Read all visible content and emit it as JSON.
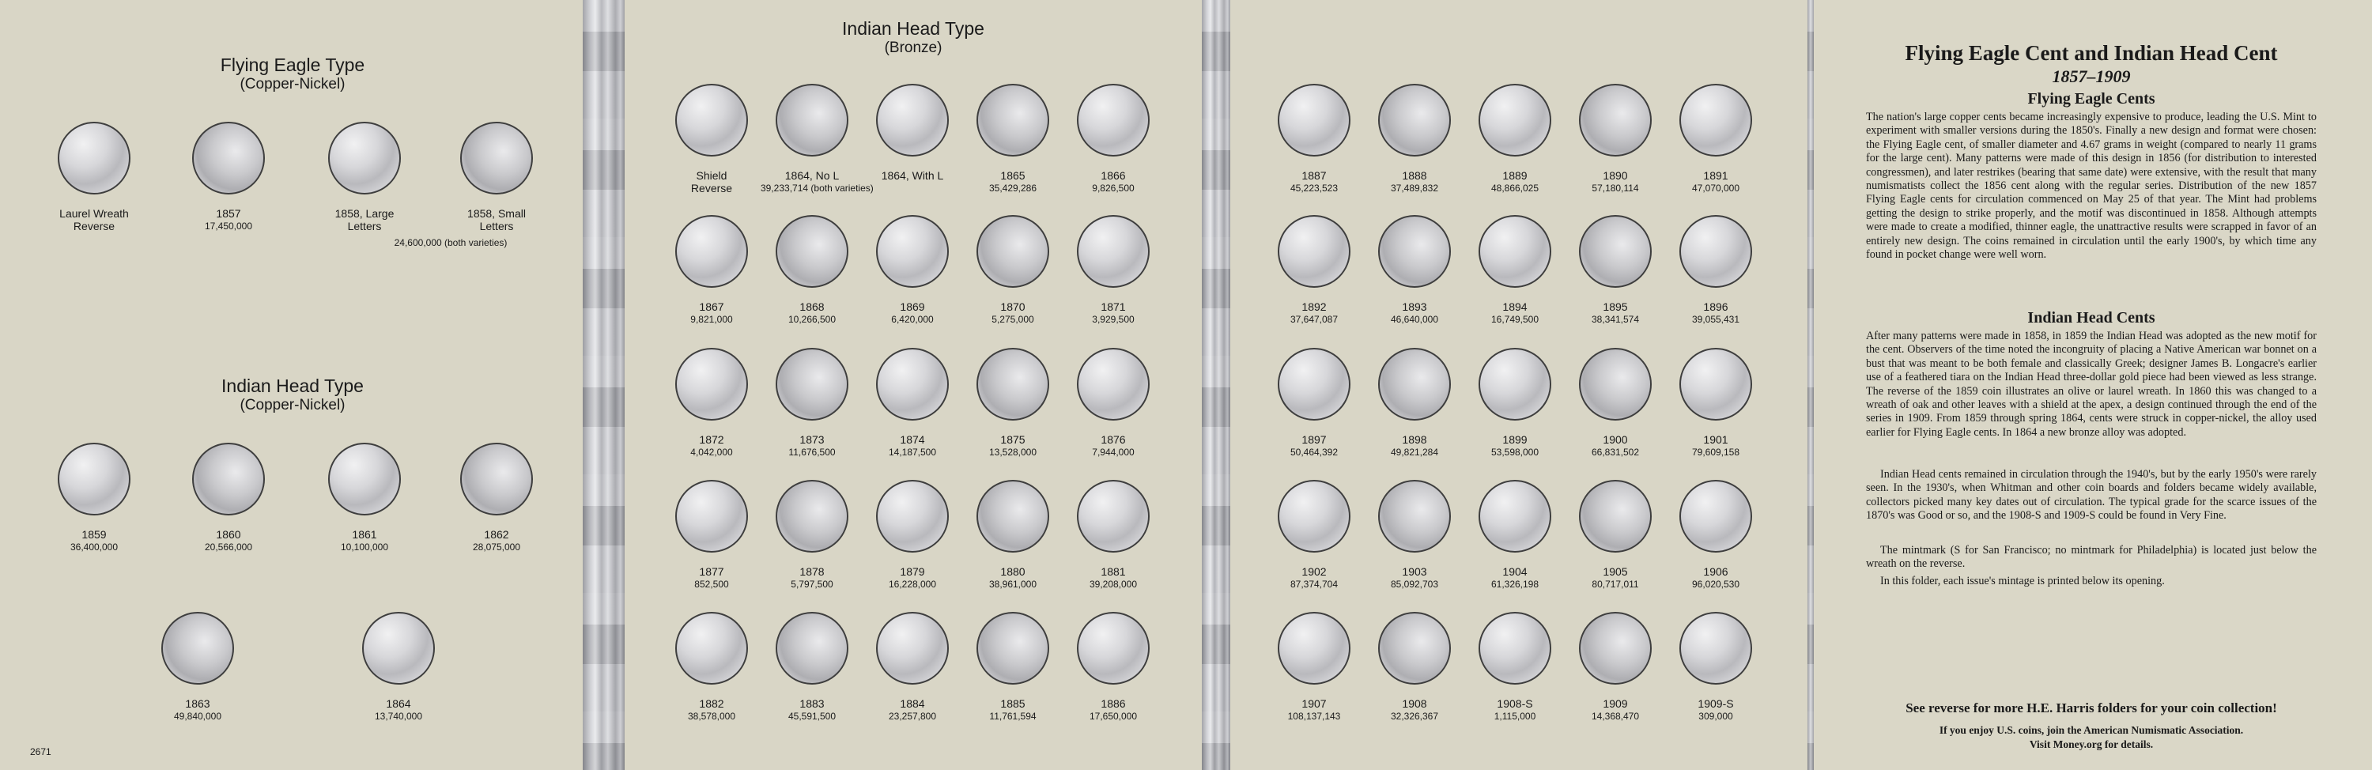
{
  "catalog_number": "2671",
  "left_panel": {
    "flying_eagle": {
      "title": "Flying Eagle Type",
      "subtitle": "(Copper-Nickel)",
      "coins": [
        {
          "label": "Laurel Wreath Reverse",
          "mintage": ""
        },
        {
          "label": "1857",
          "mintage": "17,450,000"
        },
        {
          "label": "1858, Large Letters",
          "mintage": ""
        },
        {
          "label": "1858, Small Letters",
          "mintage": ""
        }
      ],
      "shared_mintage": "24,600,000 (both varieties)"
    },
    "indian_cn": {
      "title": "Indian Head Type",
      "subtitle": "(Copper-Nickel)",
      "coins": [
        {
          "label": "1859",
          "mintage": "36,400,000"
        },
        {
          "label": "1860",
          "mintage": "20,566,000"
        },
        {
          "label": "1861",
          "mintage": "10,100,000"
        },
        {
          "label": "1862",
          "mintage": "28,075,000"
        },
        {
          "label": "1863",
          "mintage": "49,840,000"
        },
        {
          "label": "1864",
          "mintage": "13,740,000"
        }
      ]
    }
  },
  "middle_panel": {
    "title": "Indian Head Type",
    "subtitle": "(Bronze)",
    "coins": [
      {
        "label": "Shield Reverse",
        "mintage": ""
      },
      {
        "label": "1864, No L",
        "mintage": "39,233,714 (both varieties)"
      },
      {
        "label": "1864, With L",
        "mintage": ""
      },
      {
        "label": "1865",
        "mintage": "35,429,286"
      },
      {
        "label": "1866",
        "mintage": "9,826,500"
      },
      {
        "label": "1867",
        "mintage": "9,821,000"
      },
      {
        "label": "1868",
        "mintage": "10,266,500"
      },
      {
        "label": "1869",
        "mintage": "6,420,000"
      },
      {
        "label": "1870",
        "mintage": "5,275,000"
      },
      {
        "label": "1871",
        "mintage": "3,929,500"
      },
      {
        "label": "1872",
        "mintage": "4,042,000"
      },
      {
        "label": "1873",
        "mintage": "11,676,500"
      },
      {
        "label": "1874",
        "mintage": "14,187,500"
      },
      {
        "label": "1875",
        "mintage": "13,528,000"
      },
      {
        "label": "1876",
        "mintage": "7,944,000"
      },
      {
        "label": "1877",
        "mintage": "852,500"
      },
      {
        "label": "1878",
        "mintage": "5,797,500"
      },
      {
        "label": "1879",
        "mintage": "16,228,000"
      },
      {
        "label": "1880",
        "mintage": "38,961,000"
      },
      {
        "label": "1881",
        "mintage": "39,208,000"
      },
      {
        "label": "1882",
        "mintage": "38,578,000"
      },
      {
        "label": "1883",
        "mintage": "45,591,500"
      },
      {
        "label": "1884",
        "mintage": "23,257,800"
      },
      {
        "label": "1885",
        "mintage": "11,761,594"
      },
      {
        "label": "1886",
        "mintage": "17,650,000"
      }
    ]
  },
  "right_coin_panel": {
    "coins": [
      {
        "label": "1887",
        "mintage": "45,223,523"
      },
      {
        "label": "1888",
        "mintage": "37,489,832"
      },
      {
        "label": "1889",
        "mintage": "48,866,025"
      },
      {
        "label": "1890",
        "mintage": "57,180,114"
      },
      {
        "label": "1891",
        "mintage": "47,070,000"
      },
      {
        "label": "1892",
        "mintage": "37,647,087"
      },
      {
        "label": "1893",
        "mintage": "46,640,000"
      },
      {
        "label": "1894",
        "mintage": "16,749,500"
      },
      {
        "label": "1895",
        "mintage": "38,341,574"
      },
      {
        "label": "1896",
        "mintage": "39,055,431"
      },
      {
        "label": "1897",
        "mintage": "50,464,392"
      },
      {
        "label": "1898",
        "mintage": "49,821,284"
      },
      {
        "label": "1899",
        "mintage": "53,598,000"
      },
      {
        "label": "1900",
        "mintage": "66,831,502"
      },
      {
        "label": "1901",
        "mintage": "79,609,158"
      },
      {
        "label": "1902",
        "mintage": "87,374,704"
      },
      {
        "label": "1903",
        "mintage": "85,092,703"
      },
      {
        "label": "1904",
        "mintage": "61,326,198"
      },
      {
        "label": "1905",
        "mintage": "80,717,011"
      },
      {
        "label": "1906",
        "mintage": "96,020,530"
      },
      {
        "label": "1907",
        "mintage": "108,137,143"
      },
      {
        "label": "1908",
        "mintage": "32,326,367"
      },
      {
        "label": "1908-S",
        "mintage": "1,115,000"
      },
      {
        "label": "1909",
        "mintage": "14,368,470"
      },
      {
        "label": "1909-S",
        "mintage": "309,000"
      }
    ]
  },
  "info_panel": {
    "title": "Flying Eagle Cent and Indian Head Cent",
    "dates": "1857–1909",
    "fe_heading": "Flying Eagle Cents",
    "fe_text": "The nation's large copper cents became increasingly expensive to produce, leading the U.S. Mint to experiment with smaller versions during the 1850's. Finally a new design and format were chosen: the Flying Eagle cent, of smaller diameter and 4.67 grams in weight (compared to nearly 11 grams for the large cent). Many patterns were made of this design in 1856 (for distribution to interested congressmen), and later restrikes (bearing that same date) were extensive, with the result that many numismatists collect the 1856 cent along with the regular series. Distribution of the new 1857 Flying Eagle cents for circulation commenced on May 25 of that year. The Mint had problems getting the design to strike properly, and the motif was discontinued in 1858. Although attempts were made to create a modified, thinner eagle, the unattractive results were scrapped in favor of an entirely new design. The coins remained in circulation until the early 1900's, by which time any found in pocket change were well worn.",
    "ih_heading": "Indian Head Cents",
    "ih_text_1": "After many patterns were made in 1858, in 1859 the Indian Head was adopted as the new motif for the cent. Observers of the time noted the incongruity of placing a Native American war bonnet on a bust that was meant to be both female and classically Greek; designer James B. Longacre's earlier use of a feathered tiara on the Indian Head three-dollar gold piece had been viewed as less strange. The reverse of the 1859 coin illustrates an olive or laurel wreath. In 1860 this was changed to a wreath of oak and other leaves with a shield at the apex, a design continued through the end of the series in 1909. From 1859 through spring 1864, cents were struck in copper-nickel, the alloy used earlier for Flying Eagle cents. In 1864 a new bronze alloy was adopted.",
    "ih_text_2": "Indian Head cents remained in circulation through the 1940's, but by the early 1950's were rarely seen. In the 1930's, when Whitman and other coin boards and folders became widely available, collectors picked many key dates out of circulation. The typical grade for the scarce issues of the 1870's was Good or so, and the 1908-S and 1909-S could be found in Very Fine.",
    "ih_text_3": "The mintmark (S for San Francisco; no mintmark for Philadelphia) is located just below the wreath on the reverse.",
    "ih_text_4": "In this folder, each issue's mintage is printed below its opening.",
    "promo": "See reverse for more H.E. Harris folders for your coin collection!",
    "ana_line1": "If you enjoy U.S. coins, join the American Numismatic Association.",
    "ana_line2": "Visit Money.org for details."
  }
}
